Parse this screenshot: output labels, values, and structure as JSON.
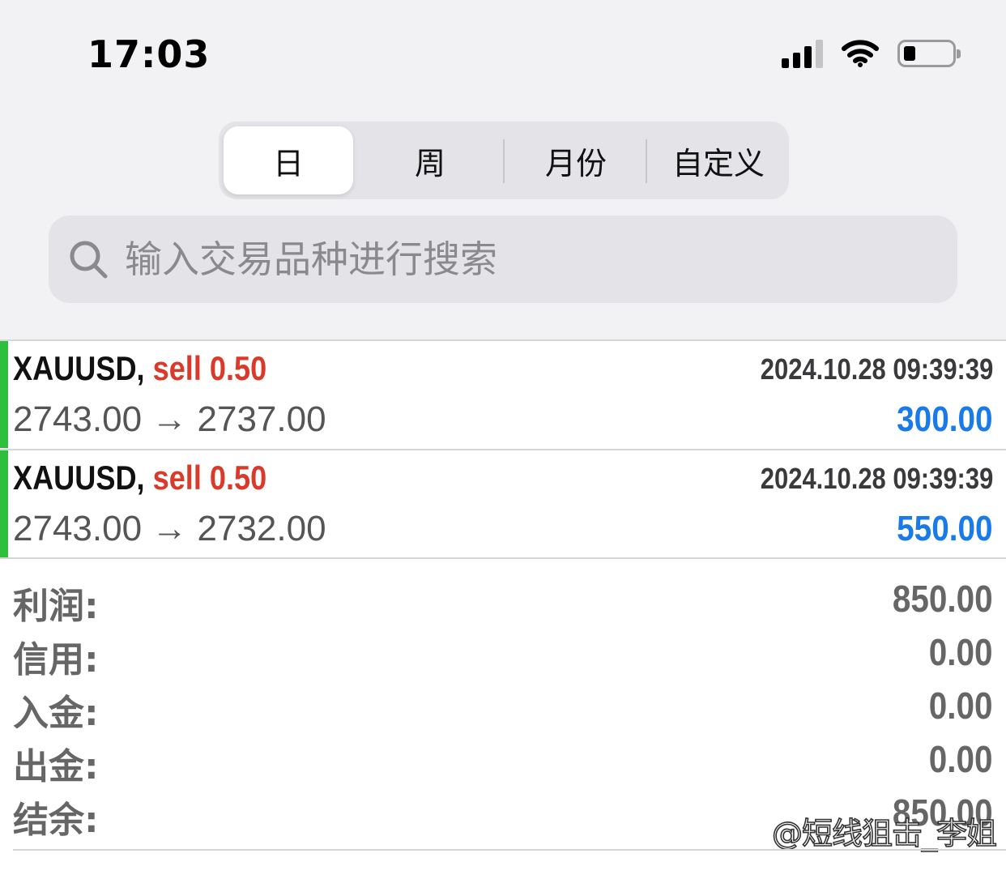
{
  "status_bar": {
    "time": "17:03",
    "icons": [
      "cellular-signal-icon",
      "wifi-icon",
      "battery-icon"
    ]
  },
  "period_tabs": [
    {
      "label": "日",
      "selected": true
    },
    {
      "label": "周",
      "selected": false
    },
    {
      "label": "月份",
      "selected": false
    },
    {
      "label": "自定义",
      "selected": false
    }
  ],
  "search": {
    "placeholder": "输入交易品种进行搜索",
    "icon": "search-icon"
  },
  "trades": [
    {
      "symbol": "XAUUSD,",
      "side_volume": "sell 0.50",
      "datetime": "2024.10.28 09:39:39",
      "prices": "2743.00 → 2737.00",
      "profit": "300.00"
    },
    {
      "symbol": "XAUUSD,",
      "side_volume": "sell 0.50",
      "datetime": "2024.10.28 09:39:39",
      "prices": "2743.00 → 2732.00",
      "profit": "550.00"
    }
  ],
  "summary": [
    {
      "label": "利润:",
      "value": "850.00"
    },
    {
      "label": "信用:",
      "value": "0.00"
    },
    {
      "label": "入金:",
      "value": "0.00"
    },
    {
      "label": "出金:",
      "value": "0.00"
    },
    {
      "label": "结余:",
      "value": "850.00"
    }
  ],
  "watermark": "@短线狙击_李姐",
  "colors": {
    "sell": "#d93a2a",
    "profit": "#1a7ae8",
    "position_bar": "#2dbf3d"
  }
}
